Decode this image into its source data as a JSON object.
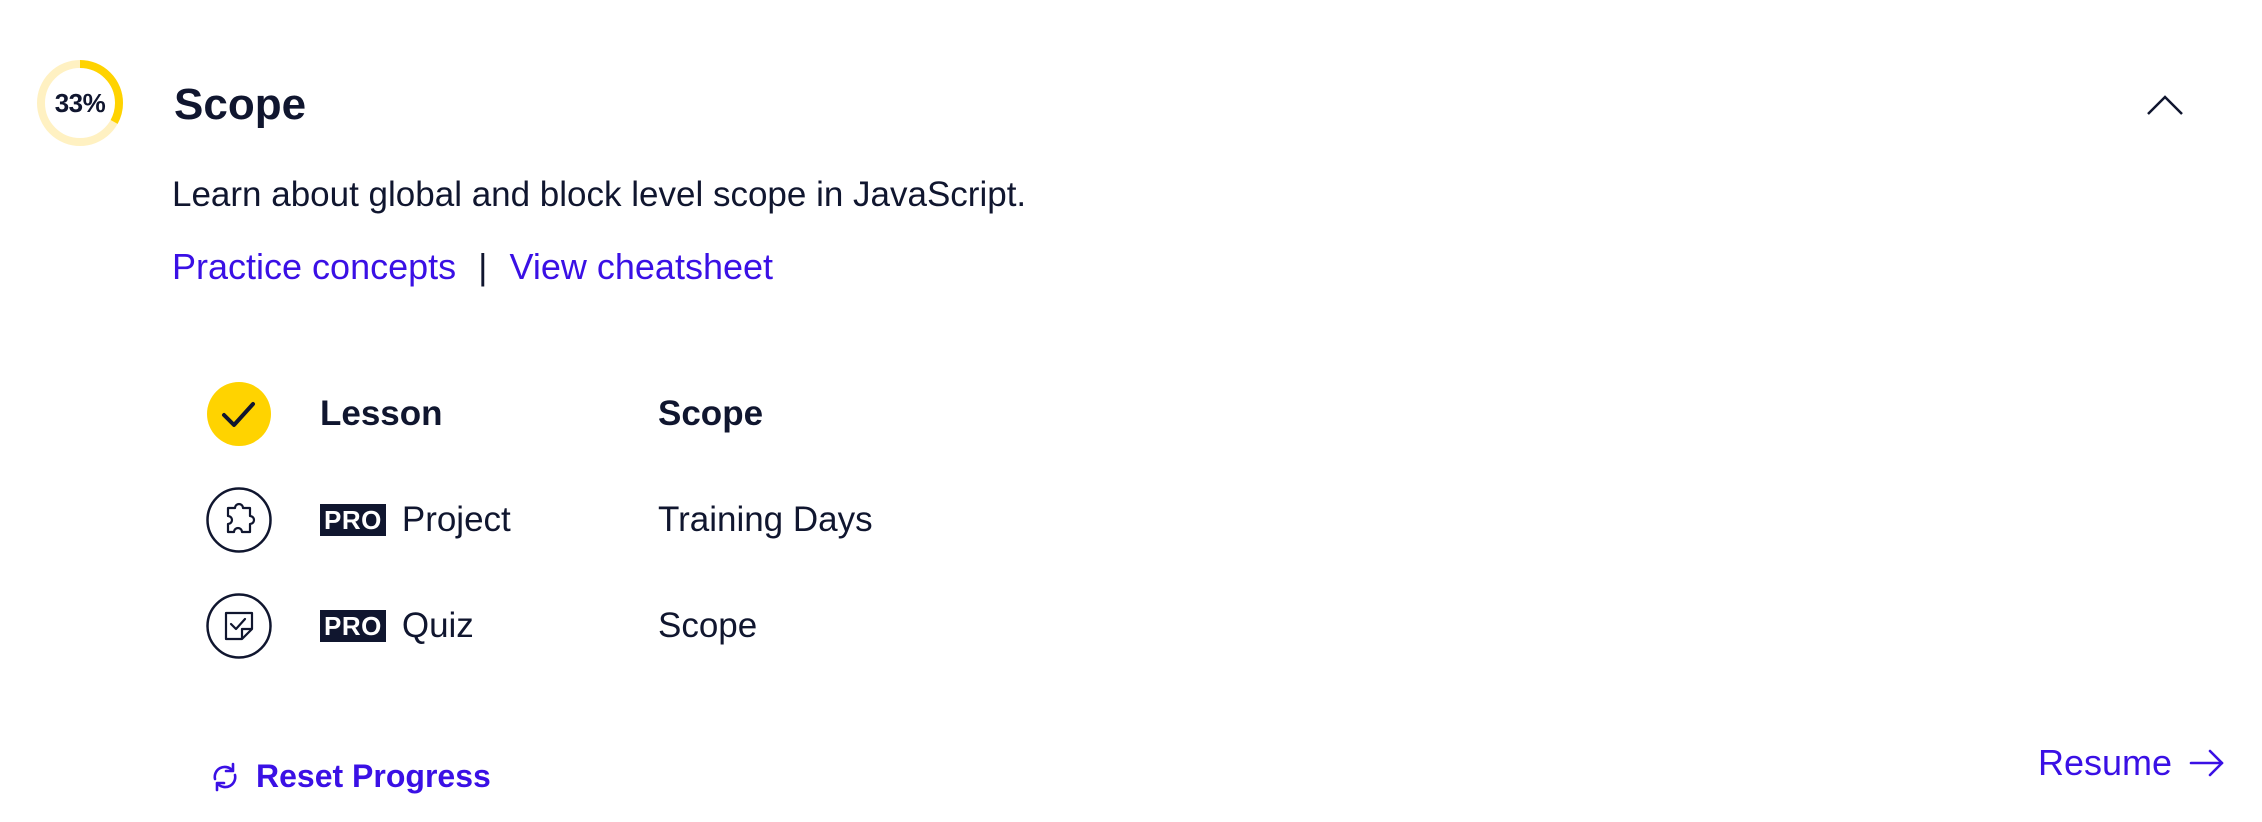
{
  "module": {
    "progress": {
      "percent": 33,
      "label": "33%",
      "track_color": "#fff1c2",
      "fill_color": "#ffd300"
    },
    "title": "Scope",
    "collapse_icon": "chevron-up-icon",
    "description": "Learn about global and block level scope in JavaScript.",
    "links": {
      "practice": "Practice concepts",
      "separator": "|",
      "cheatsheet": "View cheatsheet"
    }
  },
  "items": [
    {
      "status": "completed",
      "status_icon": "check-circle-icon",
      "pro": false,
      "type": "Lesson",
      "name": "Scope"
    },
    {
      "status": "not-started",
      "status_icon": "puzzle-icon",
      "pro": true,
      "pro_label": "PRO",
      "type": "Project",
      "name": "Training Days"
    },
    {
      "status": "not-started",
      "status_icon": "quiz-icon",
      "pro": true,
      "pro_label": "PRO",
      "type": "Quiz",
      "name": "Scope"
    }
  ],
  "actions": {
    "reset_label": "Reset Progress",
    "reset_icon": "refresh-icon",
    "resume_label": "Resume",
    "resume_icon": "arrow-right-icon"
  },
  "colors": {
    "accent": "#3a10e5",
    "text": "#10162f",
    "yellow": "#ffd300"
  }
}
